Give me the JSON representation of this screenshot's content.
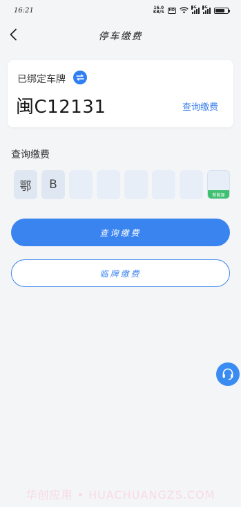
{
  "status_bar": {
    "time": "16:21",
    "net_speed_value": "16.0",
    "net_speed_unit": "KB/S",
    "hd_badge": "HD",
    "signal_label": "5G",
    "battery_level": 0.75
  },
  "header": {
    "title": "停车缴费",
    "back_icon": "chevron-left-icon"
  },
  "plate_card": {
    "label": "已绑定车牌",
    "swap_icon": "swap-arrows-icon",
    "plate_number": "闽C12131",
    "query_link": "查询缴费"
  },
  "query_section": {
    "title": "查询缴费",
    "plate_chars": [
      "鄂",
      "B",
      "",
      "",
      "",
      "",
      ""
    ],
    "new_energy_label": "新能源"
  },
  "buttons": {
    "query_pay": "查询缴费",
    "temp_plate_pay": "临牌缴费"
  },
  "support": {
    "icon": "headset-icon"
  },
  "watermark": "华创应用 • HUACHUANGZS.COM",
  "colors": {
    "accent": "#3a84f0",
    "new_energy": "#3fc070",
    "background": "#f4f5f7"
  }
}
